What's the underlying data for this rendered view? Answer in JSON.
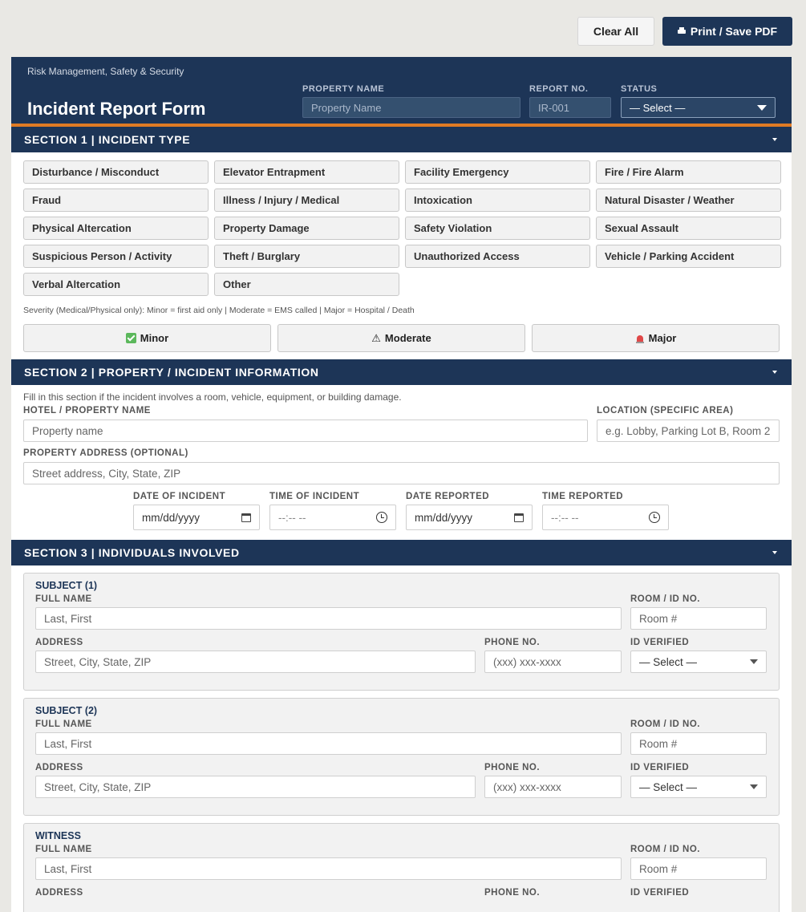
{
  "toolbar": {
    "clear_label": "Clear All",
    "print_label": "Print / Save PDF"
  },
  "header": {
    "org": "Risk Management, Safety & Security",
    "title": "Incident Report Form",
    "property_label": "PROPERTY NAME",
    "property_placeholder": "Property Name",
    "report_label": "REPORT NO.",
    "report_value": "IR-001",
    "status_label": "STATUS",
    "status_value": "— Select —"
  },
  "section1": {
    "title": "SECTION 1 | INCIDENT TYPE",
    "types": [
      "Disturbance / Misconduct",
      "Elevator Entrapment",
      "Facility Emergency",
      "Fire / Fire Alarm",
      "Fraud",
      "Illness / Injury / Medical",
      "Intoxication",
      "Natural Disaster / Weather",
      "Physical Altercation",
      "Property Damage",
      "Safety Violation",
      "Sexual Assault",
      "Suspicious Person / Activity",
      "Theft / Burglary",
      "Unauthorized Access",
      "Vehicle / Parking Accident",
      "Verbal Altercation",
      "Other"
    ],
    "severity_note": "Severity (Medical/Physical only):  Minor = first aid only  |  Moderate = EMS called  |  Major = Hospital / Death",
    "severity": [
      {
        "label": "Minor",
        "icon": "check-icon"
      },
      {
        "label": "Moderate",
        "icon": "warning-icon"
      },
      {
        "label": "Major",
        "icon": "siren-icon"
      }
    ]
  },
  "section2": {
    "title": "SECTION 2 | PROPERTY / INCIDENT INFORMATION",
    "note": "Fill in this section if the incident involves a room, vehicle, equipment, or building damage.",
    "hotel_label": "HOTEL / PROPERTY NAME",
    "hotel_placeholder": "Property name",
    "location_label": "LOCATION (SPECIFIC AREA)",
    "location_placeholder": "e.g. Lobby, Parking Lot B, Room 2",
    "address_label": "PROPERTY ADDRESS (OPTIONAL)",
    "address_placeholder": "Street address, City, State, ZIP",
    "date_incident_label": "DATE OF INCIDENT",
    "time_incident_label": "TIME OF INCIDENT",
    "date_reported_label": "DATE REPORTED",
    "time_reported_label": "TIME REPORTED",
    "date_placeholder": "mm/dd/yyyy",
    "time_placeholder": "--:-- --"
  },
  "section3": {
    "title": "SECTION 3 | INDIVIDUALS INVOLVED",
    "labels": {
      "full_name": "FULL NAME",
      "room_id": "ROOM / ID NO.",
      "address": "ADDRESS",
      "phone": "PHONE NO.",
      "id_verified": "ID VERIFIED"
    },
    "placeholders": {
      "name": "Last, First",
      "room": "Room #",
      "address": "Street, City, State, ZIP",
      "phone": "(xxx) xxx-xxxx",
      "select": "— Select —"
    },
    "cards": [
      {
        "title": "SUBJECT (1)"
      },
      {
        "title": "SUBJECT (2)"
      },
      {
        "title": "WITNESS"
      }
    ]
  }
}
